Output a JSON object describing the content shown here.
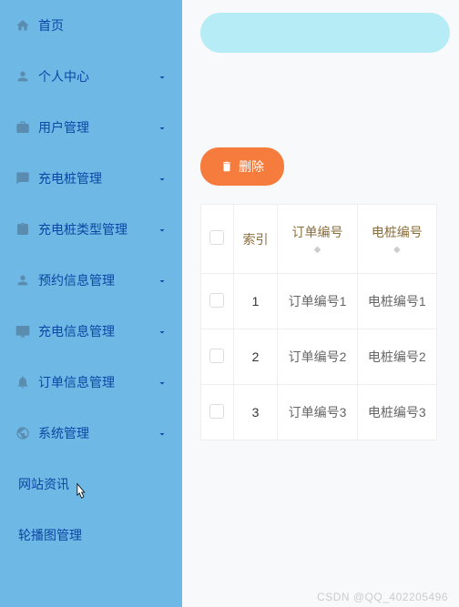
{
  "sidebar": {
    "items": [
      {
        "label": "首页",
        "icon": "home"
      },
      {
        "label": "个人中心",
        "icon": "user",
        "expandable": true
      },
      {
        "label": "用户管理",
        "icon": "briefcase",
        "expandable": true
      },
      {
        "label": "充电桩管理",
        "icon": "message",
        "expandable": true
      },
      {
        "label": "充电桩类型管理",
        "icon": "clipboard",
        "expandable": true
      },
      {
        "label": "预约信息管理",
        "icon": "user",
        "expandable": true
      },
      {
        "label": "充电信息管理",
        "icon": "monitor",
        "expandable": true
      },
      {
        "label": "订单信息管理",
        "icon": "bell",
        "expandable": true
      },
      {
        "label": "系统管理",
        "icon": "globe",
        "expandable": true
      }
    ],
    "submenu": [
      {
        "label": "网站资讯"
      },
      {
        "label": "轮播图管理"
      }
    ]
  },
  "toolbar": {
    "delete_label": "删除"
  },
  "table": {
    "headers": {
      "index": "索引",
      "orderNo": "订单编号",
      "pileNo": "电桩编号"
    },
    "rows": [
      {
        "idx": "1",
        "orderNo": "订单编号1",
        "pileNo": "电桩编号1"
      },
      {
        "idx": "2",
        "orderNo": "订单编号2",
        "pileNo": "电桩编号2"
      },
      {
        "idx": "3",
        "orderNo": "订单编号3",
        "pileNo": "电桩编号3"
      }
    ]
  },
  "watermark": "CSDN @QQ_402205496"
}
